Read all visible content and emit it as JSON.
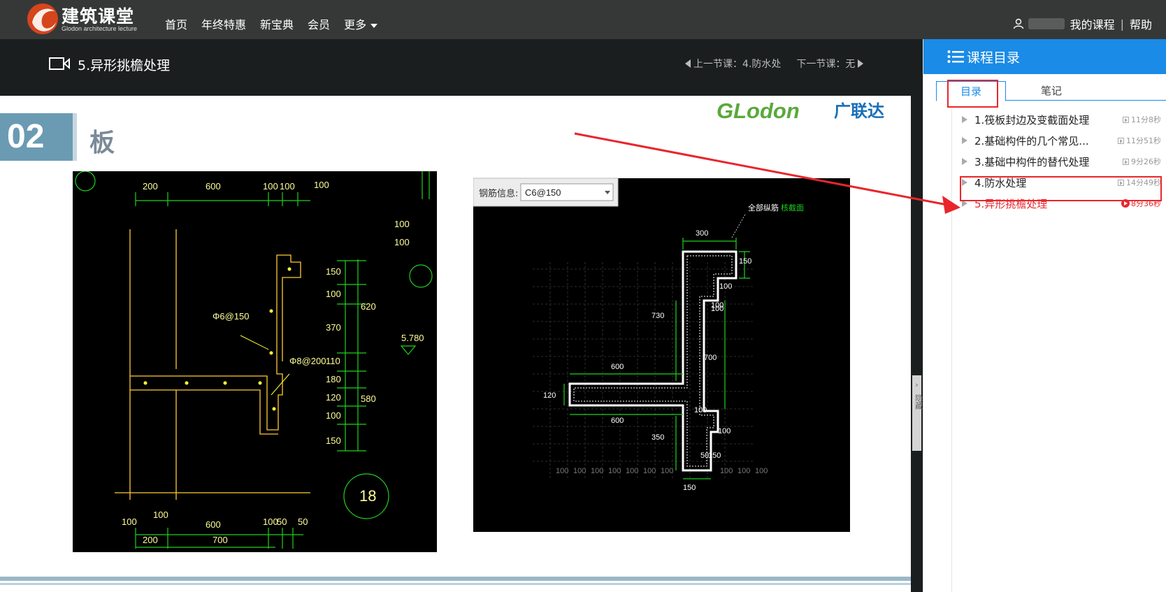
{
  "site": {
    "logo_cn": "建筑课堂",
    "logo_en": "Glodon architecture lecture",
    "nav": [
      "首页",
      "年终特惠",
      "新宝典",
      "会员",
      "更多"
    ],
    "my_courses": "我的课程",
    "separator": "|",
    "help": "帮助"
  },
  "lesson": {
    "title": "5.异形挑檐处理",
    "prev": "上一节课：4.防水处",
    "next": "下一节课：无"
  },
  "slide": {
    "number": "02",
    "title": "板",
    "brand_en": "GLodon",
    "brand_cn": "广联达",
    "side_tab": "隐藏"
  },
  "cad_left": {
    "dims_top": [
      "200",
      "600",
      "100",
      "100",
      "100"
    ],
    "dims_bottom_row1": [
      "100",
      "100",
      "600",
      "100",
      "50",
      "50"
    ],
    "dims_bottom_row2": [
      "200",
      "700"
    ],
    "dims_right": [
      "150",
      "100",
      "370",
      "110",
      "180",
      "120",
      "100",
      "150"
    ],
    "dims_right_total": [
      "620",
      "580"
    ],
    "rebar1": "Φ6@150",
    "rebar2": "Φ8@200",
    "elevation": "5.780",
    "detail_no": "18",
    "edge_dims": [
      "100",
      "100"
    ]
  },
  "cad_right": {
    "rebar_label": "钢筋信息:",
    "rebar_value": "C6@150",
    "legend_1": "全部纵筋",
    "legend_2": "核截面",
    "dims": [
      "300",
      "150",
      "100",
      "100",
      "730",
      "100",
      "700",
      "600",
      "120",
      "600",
      "100",
      "100",
      "350",
      "50",
      "150",
      "150"
    ],
    "grid_labels": [
      "100",
      "100",
      "100",
      "100",
      "100",
      "100",
      "100",
      "100",
      "100",
      "100"
    ]
  },
  "sidebar": {
    "header": "课程目录",
    "tabs": [
      "目录",
      "笔记"
    ],
    "items": [
      {
        "name": "1.筏板封边及变截面处理",
        "duration": "11分8秒",
        "active": false
      },
      {
        "name": "2.基础构件的几个常见...",
        "duration": "11分51秒",
        "active": false
      },
      {
        "name": "3.基础中构件的替代处理",
        "duration": "9分26秒",
        "active": false
      },
      {
        "name": "4.防水处理",
        "duration": "14分49秒",
        "active": false
      },
      {
        "name": "5.异形挑檐处理",
        "duration": "8分36秒",
        "active": true
      }
    ]
  },
  "colors": {
    "topbar": "#363838",
    "lessonbar": "#1b1e1e",
    "sidebar_header": "#1a8be6",
    "highlight": "#e8262c",
    "cad_green": "#1fd11f",
    "cad_yellow": "#ffff33"
  }
}
